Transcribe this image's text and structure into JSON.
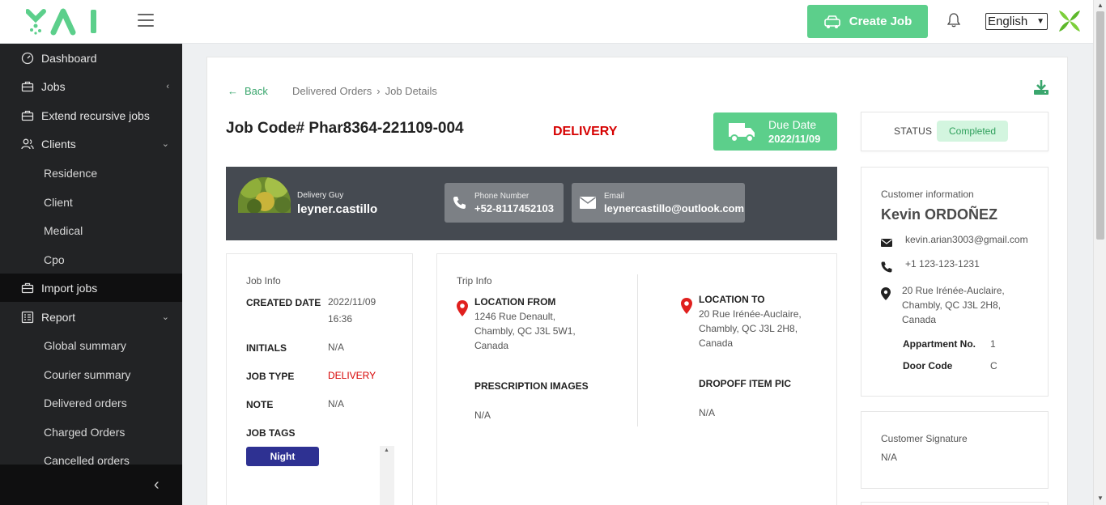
{
  "header": {
    "create_job_label": "Create Job",
    "language": "English"
  },
  "sidebar": {
    "items": [
      {
        "label": "Dashboard"
      },
      {
        "label": "Jobs"
      },
      {
        "label": "Extend recursive jobs"
      },
      {
        "label": "Clients"
      },
      {
        "label": "Import jobs"
      },
      {
        "label": "Report"
      }
    ],
    "clients_sub": [
      "Residence",
      "Client",
      "Medical",
      "Cpo"
    ],
    "report_sub": [
      "Global summary",
      "Courier summary",
      "Delivered orders",
      "Charged Orders",
      "Cancelled orders"
    ]
  },
  "breadcrumb": {
    "back": "Back",
    "parent": "Delivered Orders",
    "current": "Job Details"
  },
  "job": {
    "code": "Job Code# Phar8364-221109-004",
    "type_heading": "DELIVERY",
    "due_label": "Due Date",
    "due_date": "2022/11/09",
    "status_label": "STATUS",
    "status": "Completed"
  },
  "driver": {
    "role_label": "Delivery Guy",
    "name": "leyner.castillo",
    "phone_label": "Phone Number",
    "phone": "+52-8117452103",
    "email_label": "Email",
    "email": "leynercastillo@outlook.com"
  },
  "job_info": {
    "title": "Job Info",
    "created_label": "CREATED DATE",
    "created_date": "2022/11/09",
    "created_time": "16:36",
    "initials_label": "INITIALS",
    "initials": "N/A",
    "job_type_label": "JOB TYPE",
    "job_type": "DELIVERY",
    "note_label": "NOTE",
    "note": "N/A",
    "tags_label": "JOB TAGS",
    "tags": [
      "Night"
    ]
  },
  "trip_info": {
    "title": "Trip Info",
    "from_label": "LOCATION FROM",
    "from_lines": [
      "1246 Rue Denault,",
      "Chambly, QC J3L 5W1,",
      "Canada"
    ],
    "to_label": "LOCATION TO",
    "to_lines": [
      "20 Rue Irénée-Auclaire,",
      "Chambly, QC J3L 2H8,",
      "Canada"
    ],
    "prescription_label": "PRESCRIPTION IMAGES",
    "prescription": "N/A",
    "dropoff_label": "DROPOFF ITEM PIC",
    "dropoff": "N/A"
  },
  "customer": {
    "label": "Customer information",
    "name": "Kevin ORDOÑEZ",
    "email": "kevin.arian3003@gmail.com",
    "phone": "+1 123-123-1231",
    "address_lines": [
      "20 Rue Irénée-Auclaire,",
      "Chambly, QC J3L 2H8,",
      "Canada"
    ],
    "apartment_label": "Appartment No.",
    "apartment": "1",
    "door_label": "Door Code",
    "door": "C"
  },
  "signature": {
    "label": "Customer Signature",
    "value": "N/A"
  },
  "colors": {
    "accent": "#5ccf8b",
    "sidebar": "#222325",
    "driver_bar": "#454a51",
    "danger": "#d60000",
    "tag": "#2e3192"
  }
}
